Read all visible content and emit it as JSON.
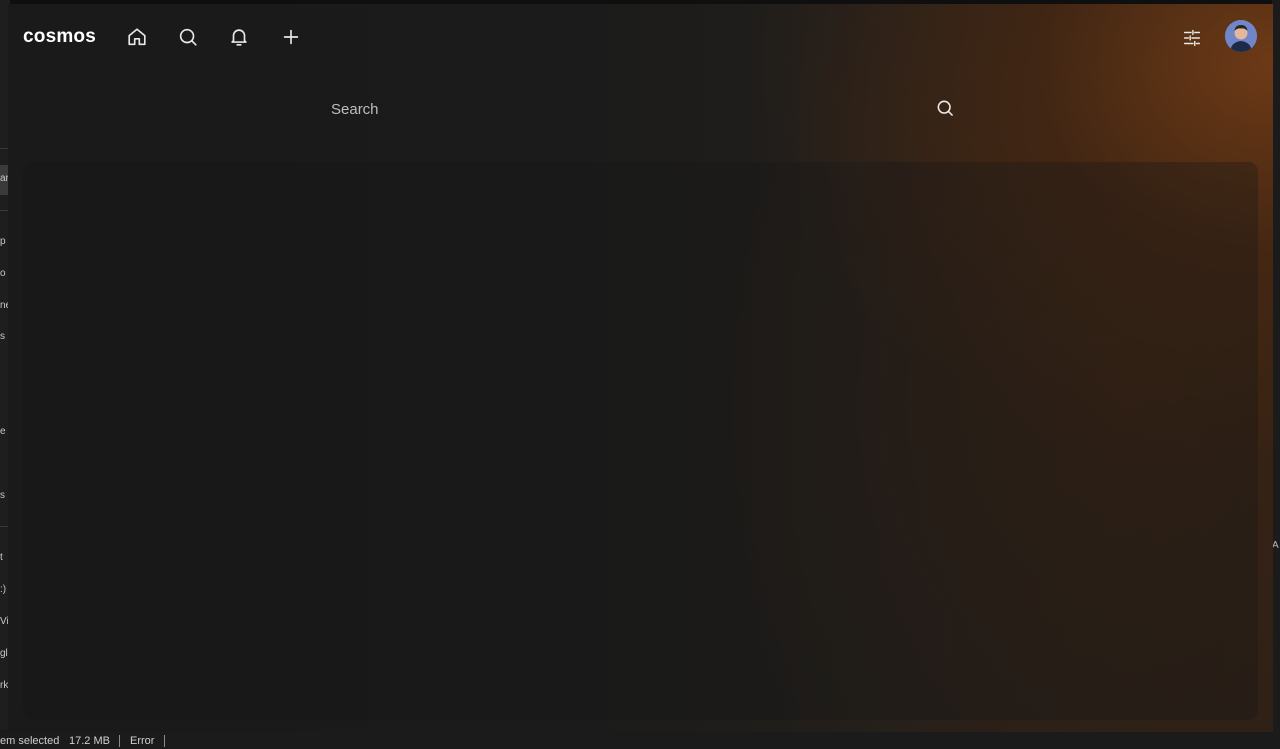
{
  "app": {
    "brand": "cosmos",
    "nav": [
      {
        "name": "home",
        "icon": "home-icon"
      },
      {
        "name": "search",
        "icon": "search-icon"
      },
      {
        "name": "notifications",
        "icon": "bell-icon"
      },
      {
        "name": "create",
        "icon": "plus-icon"
      }
    ],
    "settings_icon": "sliders-icon",
    "avatar_icon": "user-avatar",
    "search": {
      "placeholder": "Search",
      "icon": "search-icon"
    },
    "colors": {
      "background": "#1a1a1b",
      "accent_glow": "#7a3e16",
      "text": "#ffffff"
    }
  },
  "background_window": {
    "sidebar_fragments": [
      "p",
      "o",
      "ne",
      "s",
      "e",
      "s",
      "t",
      ":)",
      "Vi",
      "gle",
      "rk",
      "ar"
    ],
    "right_fragment": "A",
    "statusbar": {
      "selection": "em selected",
      "size": "17.2 MB",
      "status": "Error"
    }
  }
}
